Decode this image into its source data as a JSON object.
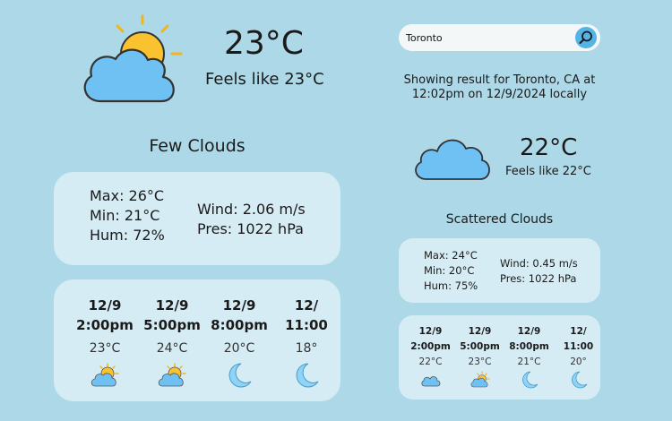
{
  "main": {
    "temp": "23°C",
    "feels_like": "Feels like 23°C",
    "description": "Few Clouds",
    "icon": "cloud-sun-icon",
    "stats": {
      "max": "Max: 26°C",
      "min": "Min: 21°C",
      "hum": "Hum: 72%",
      "wind": "Wind: 2.06 m/s",
      "pres": "Pres: 1022 hPa"
    },
    "forecast": [
      {
        "date": "12/9",
        "time": "2:00pm",
        "temp": "23°C",
        "icon": "cloud-sun-icon"
      },
      {
        "date": "12/9",
        "time": "5:00pm",
        "temp": "24°C",
        "icon": "cloud-sun-icon"
      },
      {
        "date": "12/9",
        "time": "8:00pm",
        "temp": "20°C",
        "icon": "moon-icon"
      },
      {
        "date": "12/",
        "time": "11:00",
        "temp": "18°",
        "icon": "moon-icon"
      }
    ]
  },
  "search": {
    "value": "Toronto",
    "button_icon": "search-icon"
  },
  "result": {
    "line1": "Showing result for Toronto, CA at",
    "line2": "12:02pm on 12/9/2024 locally"
  },
  "secondary": {
    "temp": "22°C",
    "feels_like": "Feels like 22°C",
    "description": "Scattered Clouds",
    "icon": "cloud-icon",
    "stats": {
      "max": "Max: 24°C",
      "min": "Min: 20°C",
      "hum": "Hum: 75%",
      "wind": "Wind: 0.45 m/s",
      "pres": "Pres: 1022 hPa"
    },
    "forecast": [
      {
        "date": "12/9",
        "time": "2:00pm",
        "temp": "22°C",
        "icon": "cloud-icon"
      },
      {
        "date": "12/9",
        "time": "5:00pm",
        "temp": "23°C",
        "icon": "cloud-sun-icon"
      },
      {
        "date": "12/9",
        "time": "8:00pm",
        "temp": "21°C",
        "icon": "moon-icon"
      },
      {
        "date": "12/",
        "time": "11:00",
        "temp": "20°",
        "icon": "moon-icon"
      }
    ]
  },
  "colors": {
    "background": "#acd8e7",
    "card": "#d6ecf4",
    "cloud": "#6ec1f2",
    "sun": "#f9c22e",
    "moon": "#8fd3f7",
    "search_button": "#55b4e6"
  }
}
